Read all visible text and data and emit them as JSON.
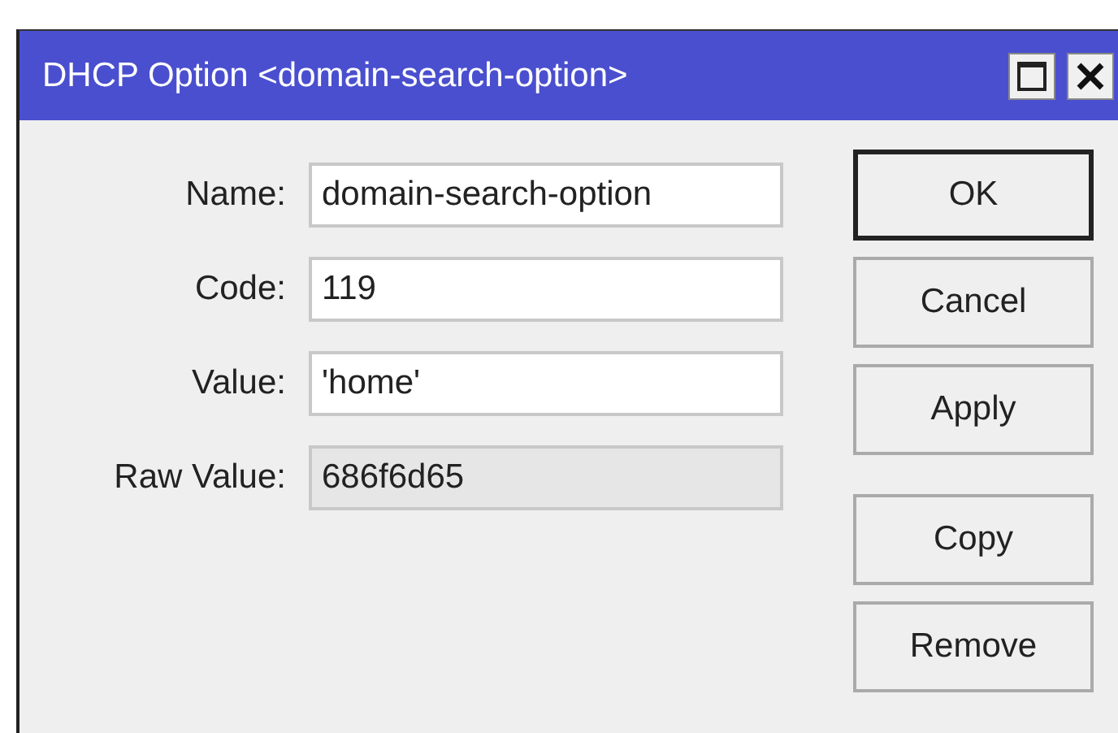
{
  "window": {
    "title": "DHCP Option <domain-search-option>"
  },
  "fields": [
    {
      "label": "Name:",
      "value": "domain-search-option",
      "disabled": false
    },
    {
      "label": "Code:",
      "value": "119",
      "disabled": false
    },
    {
      "label": "Value:",
      "value": "'home'",
      "disabled": false
    },
    {
      "label": "Raw Value:",
      "value": "686f6d65",
      "disabled": true
    }
  ],
  "button_groups": [
    [
      {
        "label": "OK",
        "default": true
      },
      {
        "label": "Cancel",
        "default": false
      },
      {
        "label": "Apply",
        "default": false
      }
    ],
    [
      {
        "label": "Copy",
        "default": false
      },
      {
        "label": "Remove",
        "default": false
      }
    ]
  ]
}
